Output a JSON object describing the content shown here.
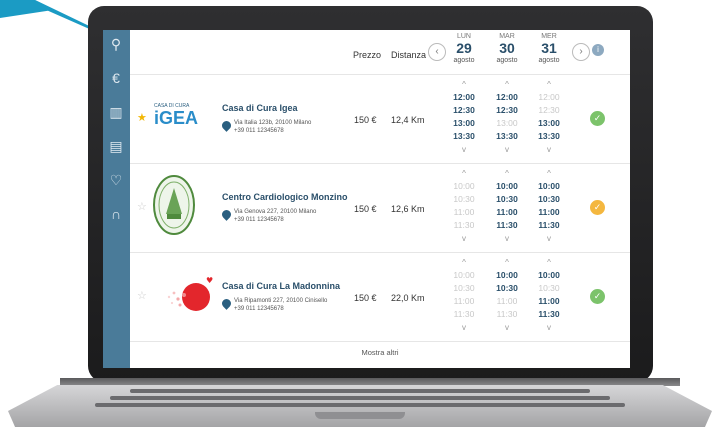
{
  "colors": {
    "sidebar": "#4a7b99",
    "accent": "#2a4f6a",
    "green": "#7cc36b",
    "orange": "#f4b73f",
    "star": "#f2b705"
  },
  "sidebar": {
    "icons": [
      "bicycle-icon",
      "euro-icon",
      "chart-icon",
      "document-icon",
      "heart-icon",
      "headset-icon"
    ]
  },
  "header": {
    "price_label": "Prezzo",
    "distance_label": "Distanza",
    "days": [
      {
        "name": "LUN",
        "day": "29",
        "month": "agosto"
      },
      {
        "name": "MAR",
        "day": "30",
        "month": "agosto"
      },
      {
        "name": "MER",
        "day": "31",
        "month": "agosto"
      }
    ],
    "prev": "‹",
    "next": "›",
    "info": "i"
  },
  "rows": [
    {
      "logo_small": "CASA DI CURA",
      "logo_big": "iGEA",
      "name": "Casa di Cura Igea",
      "address": "Via Italia 123b, 20100 Milano",
      "phone": "+39 011 12345678",
      "price": "150 €",
      "distance": "12,4 Km",
      "status": "available",
      "cols": [
        [
          "12:00",
          "12:30",
          "13:00",
          "13:30"
        ],
        [
          "12:00",
          "12:30",
          "13:00",
          "13:30"
        ],
        [
          "12:00",
          "12:30",
          "13:00",
          "13:30"
        ]
      ]
    },
    {
      "name": "Centro Cardiologico Monzino",
      "address": "Via Genova 227, 20100 Milano",
      "phone": "+39 011 12345678",
      "price": "150 €",
      "distance": "12,6 Km",
      "status": "limited",
      "cols": [
        [
          "10:00",
          "10:30",
          "11:00",
          "11:30"
        ],
        [
          "10:00",
          "10:30",
          "11:00",
          "11:30"
        ],
        [
          "10:00",
          "10:30",
          "11:00",
          "11:30"
        ]
      ]
    },
    {
      "name": "Casa di Cura La Madonnina",
      "address": "Via Ripamonti 227, 20100 Cinisello",
      "phone": "+39 011 12345678",
      "price": "150 €",
      "distance": "22,0 Km",
      "status": "available",
      "cols": [
        [
          "10:00",
          "10:30",
          "11:00",
          "11:30"
        ],
        [
          "10:00",
          "10:30",
          "11:00",
          "11:30"
        ],
        [
          "10:00",
          "10:30",
          "11:00",
          "11:30"
        ]
      ]
    }
  ],
  "more_label": "Mostra altri",
  "chevron_up": "^",
  "chevron_down": "v"
}
